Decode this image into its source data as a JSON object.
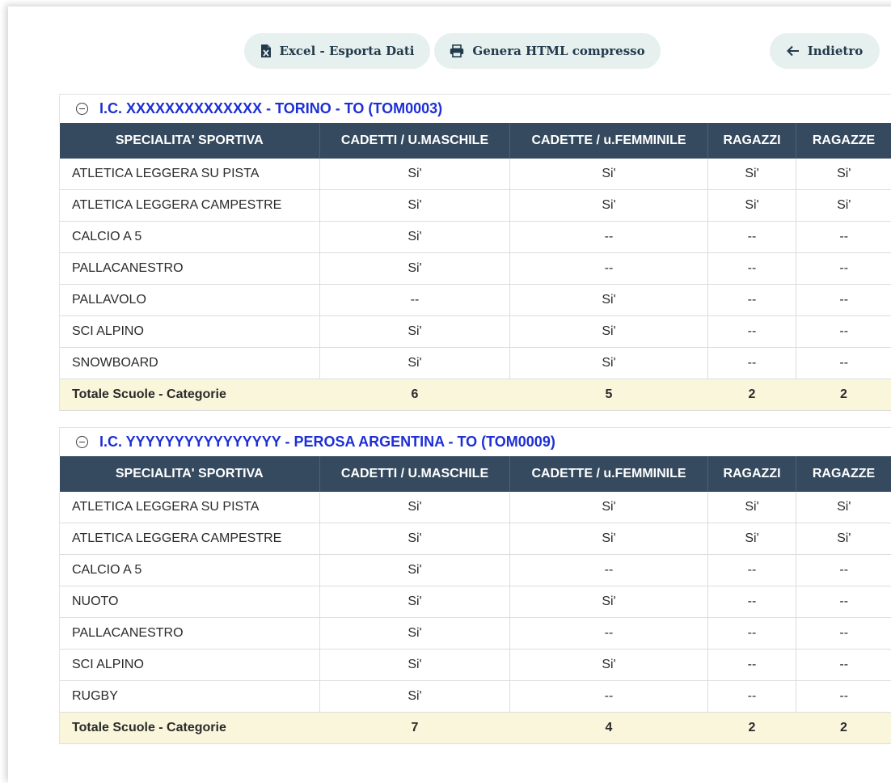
{
  "toolbar": {
    "excel_label": "Excel - Esporta Dati",
    "html_label": "Genera HTML compresso",
    "back_label": "Indietro"
  },
  "table_headers": [
    "SPECIALITA' SPORTIVA",
    "CADETTI / U.MASCHILE",
    "CADETTE / u.FEMMINILE",
    "RAGAZZI",
    "RAGAZZE"
  ],
  "schools": [
    {
      "title": "I.C. XXXXXXXXXXXXXX - TORINO - TO (TOM0003)",
      "rows": [
        [
          "ATLETICA LEGGERA SU PISTA",
          "Si'",
          "Si'",
          "Si'",
          "Si'"
        ],
        [
          "ATLETICA LEGGERA CAMPESTRE",
          "Si'",
          "Si'",
          "Si'",
          "Si'"
        ],
        [
          "CALCIO A 5",
          "Si'",
          "--",
          "--",
          "--"
        ],
        [
          "PALLACANESTRO",
          "Si'",
          "--",
          "--",
          "--"
        ],
        [
          "PALLAVOLO",
          "--",
          "Si'",
          "--",
          "--"
        ],
        [
          "SCI ALPINO",
          "Si'",
          "Si'",
          "--",
          "--"
        ],
        [
          "SNOWBOARD",
          "Si'",
          "Si'",
          "--",
          "--"
        ]
      ],
      "total": [
        "Totale Scuole - Categorie",
        "6",
        "5",
        "2",
        "2"
      ]
    },
    {
      "title": "I.C. YYYYYYYYYYYYYYYY - PEROSA ARGENTINA - TO (TOM0009)",
      "rows": [
        [
          "ATLETICA LEGGERA SU PISTA",
          "Si'",
          "Si'",
          "Si'",
          "Si'"
        ],
        [
          "ATLETICA LEGGERA CAMPESTRE",
          "Si'",
          "Si'",
          "Si'",
          "Si'"
        ],
        [
          "CALCIO A 5",
          "Si'",
          "--",
          "--",
          "--"
        ],
        [
          "NUOTO",
          "Si'",
          "Si'",
          "--",
          "--"
        ],
        [
          "PALLACANESTRO",
          "Si'",
          "--",
          "--",
          "--"
        ],
        [
          "SCI ALPINO",
          "Si'",
          "Si'",
          "--",
          "--"
        ],
        [
          "RUGBY",
          "Si'",
          "--",
          "--",
          "--"
        ]
      ],
      "total": [
        "Totale Scuole - Categorie",
        "7",
        "4",
        "2",
        "2"
      ]
    }
  ],
  "colors": {
    "header_bg": "#354a5f",
    "title_blue": "#1d2fd6",
    "total_bg": "#faf6dc",
    "button_bg": "#e6f0ee"
  },
  "icons": {
    "excel": "excel-file-icon",
    "html": "printer-icon",
    "back": "arrow-left-icon",
    "toggle": "collapse-minus-icon"
  }
}
